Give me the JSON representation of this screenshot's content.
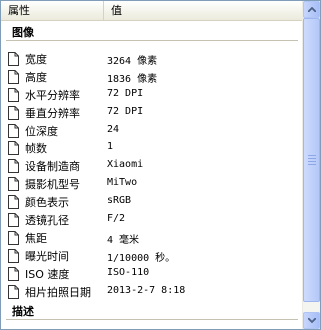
{
  "header": {
    "col_name": "属性",
    "col_value": "值"
  },
  "sections": {
    "image_title": "图像",
    "desc_title": "描述"
  },
  "properties": [
    {
      "label": "宽度",
      "value": "3264 像素"
    },
    {
      "label": "高度",
      "value": "1836 像素"
    },
    {
      "label": "水平分辨率",
      "value": "72 DPI"
    },
    {
      "label": "垂直分辨率",
      "value": "72 DPI"
    },
    {
      "label": "位深度",
      "value": "24"
    },
    {
      "label": "帧数",
      "value": "1"
    },
    {
      "label": "设备制造商",
      "value": "Xiaomi"
    },
    {
      "label": "摄影机型号",
      "value": "MiTwo"
    },
    {
      "label": "颜色表示",
      "value": "sRGB"
    },
    {
      "label": "透镜孔径",
      "value": "F/2"
    },
    {
      "label": "焦距",
      "value": "4 毫米"
    },
    {
      "label": "曝光时间",
      "value": "1/10000 秒。"
    },
    {
      "label": "ISO 速度",
      "value": "ISO-110"
    },
    {
      "label": "相片拍照日期",
      "value": "2013-2-7 8:18"
    }
  ],
  "colors": {
    "border": "#7f9db9",
    "scrollbar": "#b4c8f8"
  },
  "icons": {
    "row_icon": "document-icon",
    "scroll_up": "arrow-up-icon",
    "scroll_down": "arrow-down-icon"
  }
}
